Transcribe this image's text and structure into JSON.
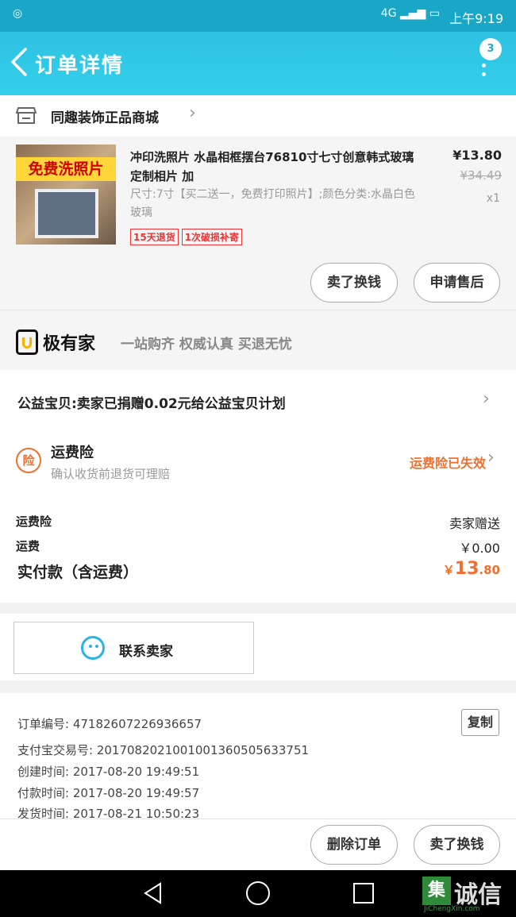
{
  "status_bar": {
    "time": "上午9:19",
    "signal": "4G",
    "app_icon": "alipay-icon"
  },
  "header": {
    "title": "订单详情",
    "badge": "3"
  },
  "shop": {
    "name": "同趣装饰正品商城"
  },
  "product": {
    "image_banner": "免费洗照片",
    "title": "冲印洗照片 水晶相框摆台76810寸七寸创意韩式玻璃定制相片 加",
    "attributes": "尺寸:7寸【买二送一，免费打印照片】;颜色分类:水晶白色玻璃",
    "tags": [
      "15天退货",
      "1次破损补寄"
    ],
    "price": "¥13.80",
    "original_price": "¥34.49",
    "quantity": "x1",
    "buttons": {
      "exchange": "卖了换钱",
      "after_sale": "申请售后"
    }
  },
  "brand": {
    "name": "极有家",
    "slogan": "一站购齐 权威认真 买退无忧"
  },
  "info": {
    "charity": "公益宝贝:卖家已捐赠0.02元给公益宝贝计划",
    "insurance": {
      "icon_text": "险",
      "title": "运费险",
      "subtitle": "确认收货前退货可理赔",
      "status": "运费险已失效"
    },
    "rows": [
      {
        "label": "运费险",
        "value": "卖家赠送"
      },
      {
        "label": "运费",
        "value": "￥0.00"
      }
    ],
    "total": {
      "label": "实付款（含运费）",
      "currency": "￥",
      "main": "13",
      "decimal": ".80"
    }
  },
  "contact": {
    "label": "联系卖家"
  },
  "order": {
    "number": "订单编号: 4718260722693665​7",
    "alipay_no": "支付宝交易号: 2017082021001001360505633751",
    "created": "创建时间: 2017-08-20 19:49:51",
    "paid": "付款时间: 2017-08-20 19:49:57",
    "shipped": "发货时间: 2017-08-21 10:50:23",
    "copy_label": "复制"
  },
  "actions": {
    "delete": "删除订单",
    "exchange": "卖了换钱"
  },
  "watermark": {
    "mark": "集",
    "text": "诚信",
    "url": "JiChengXin.com"
  },
  "colors": {
    "header": "#33cdea",
    "accent_orange": "#f07030",
    "tag_red": "#e33333",
    "contact_blue": "#2db2e8"
  }
}
